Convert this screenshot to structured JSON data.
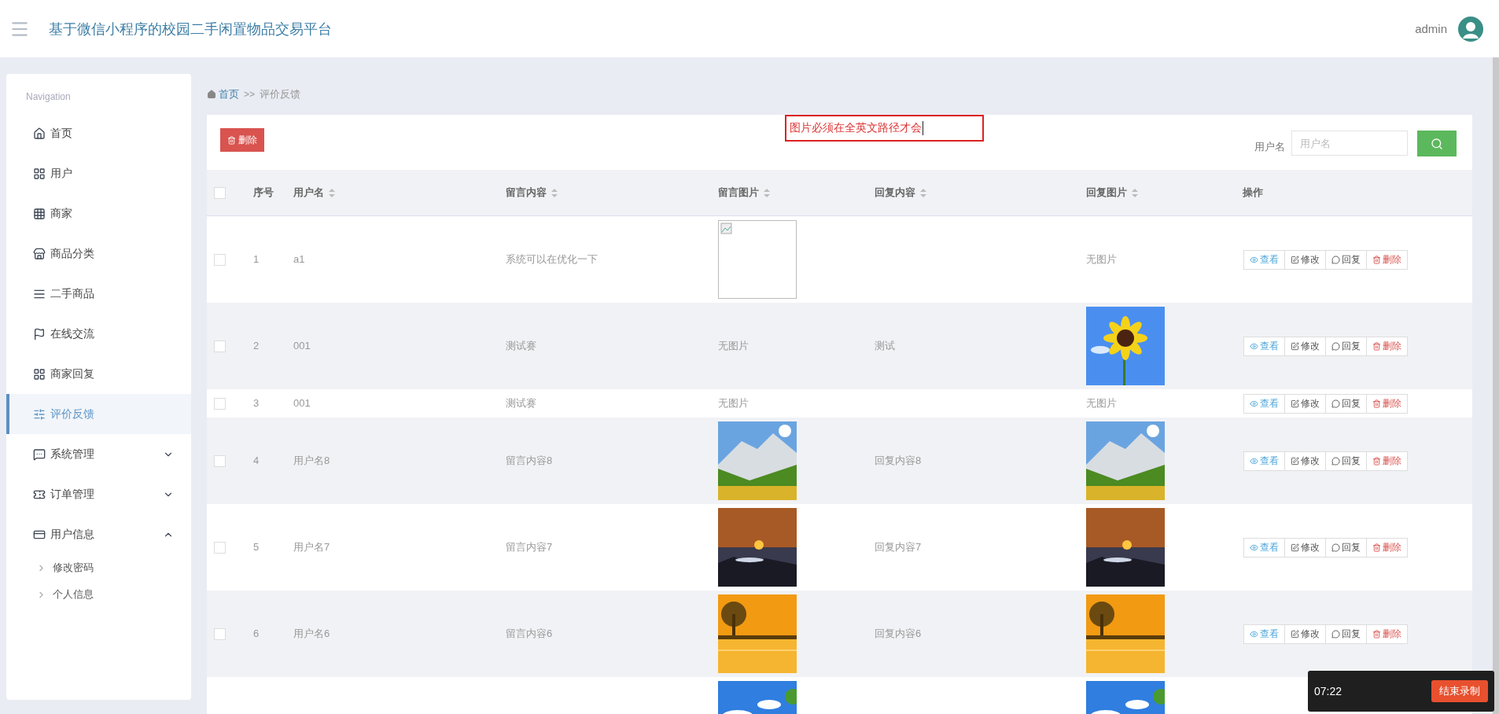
{
  "header": {
    "title": "基于微信小程序的校园二手闲置物品交易平台",
    "user": "admin"
  },
  "sidebar": {
    "heading": "Navigation",
    "items": [
      {
        "label": "首页",
        "selected": false
      },
      {
        "label": "用户",
        "selected": false
      },
      {
        "label": "商家",
        "selected": false
      },
      {
        "label": "商品分类",
        "selected": false
      },
      {
        "label": "二手商品",
        "selected": false
      },
      {
        "label": "在线交流",
        "selected": false
      },
      {
        "label": "商家回复",
        "selected": false
      },
      {
        "label": "评价反馈",
        "selected": true
      },
      {
        "label": "系统管理",
        "selected": false,
        "expanded": false
      },
      {
        "label": "订单管理",
        "selected": false,
        "expanded": false
      },
      {
        "label": "用户信息",
        "selected": false,
        "expanded": true,
        "children": [
          {
            "label": "修改密码"
          },
          {
            "label": "个人信息"
          }
        ]
      }
    ]
  },
  "breadcrumb": {
    "home": "首页",
    "separator": ">>",
    "current": "评价反馈"
  },
  "toolbar": {
    "delete_button": "删除",
    "search_label": "用户名",
    "search_placeholder": "用户名"
  },
  "annotation": {
    "text": "图片必须在全英文路径才会"
  },
  "table": {
    "columns": [
      {
        "label": "序号",
        "sortable": false
      },
      {
        "label": "用户名",
        "sortable": true
      },
      {
        "label": "留言内容",
        "sortable": true
      },
      {
        "label": "留言图片",
        "sortable": true
      },
      {
        "label": "回复内容",
        "sortable": true
      },
      {
        "label": "回复图片",
        "sortable": true
      },
      {
        "label": "操作",
        "sortable": false
      }
    ],
    "header_checked": false,
    "rows": [
      {
        "checked": false,
        "index": "1",
        "user": "a1",
        "message": "系统可以在优化一下",
        "message_picture": {
          "kind": "broken"
        },
        "reply": "",
        "reply_picture": {
          "kind": "none",
          "text": "无图片"
        },
        "actions": [
          {
            "kind": "view",
            "label": "查看"
          },
          {
            "kind": "edit",
            "label": "修改"
          },
          {
            "kind": "reply",
            "label": "回复"
          },
          {
            "kind": "delete",
            "label": "删除"
          }
        ]
      },
      {
        "checked": false,
        "index": "2",
        "user": "001",
        "message": "测试赛",
        "message_picture": {
          "kind": "none",
          "text": "无图片"
        },
        "reply": "测试",
        "reply_picture": {
          "kind": "picture"
        },
        "actions": [
          {
            "kind": "view",
            "label": "查看"
          },
          {
            "kind": "edit",
            "label": "修改"
          },
          {
            "kind": "reply",
            "label": "回复"
          },
          {
            "kind": "delete",
            "label": "删除"
          }
        ]
      },
      {
        "checked": false,
        "index": "3",
        "user": "001",
        "message": "测试赛",
        "message_picture": {
          "kind": "none",
          "text": "无图片"
        },
        "reply": "",
        "reply_picture": {
          "kind": "none",
          "text": "无图片"
        },
        "actions": [
          {
            "kind": "view",
            "label": "查看"
          },
          {
            "kind": "edit",
            "label": "修改"
          },
          {
            "kind": "reply",
            "label": "回复"
          },
          {
            "kind": "delete",
            "label": "删除"
          }
        ]
      },
      {
        "checked": false,
        "index": "4",
        "user": "用户名8",
        "message": "留言内容8",
        "message_picture": {
          "kind": "picture"
        },
        "reply": "回复内容8",
        "reply_picture": {
          "kind": "picture"
        },
        "actions": [
          {
            "kind": "view",
            "label": "查看"
          },
          {
            "kind": "edit",
            "label": "修改"
          },
          {
            "kind": "reply",
            "label": "回复"
          },
          {
            "kind": "delete",
            "label": "删除"
          }
        ]
      },
      {
        "checked": false,
        "index": "5",
        "user": "用户名7",
        "message": "留言内容7",
        "message_picture": {
          "kind": "picture"
        },
        "reply": "回复内容7",
        "reply_picture": {
          "kind": "picture"
        },
        "actions": [
          {
            "kind": "view",
            "label": "查看"
          },
          {
            "kind": "edit",
            "label": "修改"
          },
          {
            "kind": "reply",
            "label": "回复"
          },
          {
            "kind": "delete",
            "label": "删除"
          }
        ]
      },
      {
        "checked": false,
        "index": "6",
        "user": "用户名6",
        "message": "留言内容6",
        "message_picture": {
          "kind": "picture"
        },
        "reply": "回复内容6",
        "reply_picture": {
          "kind": "picture"
        },
        "actions": [
          {
            "kind": "view",
            "label": "查看"
          },
          {
            "kind": "edit",
            "label": "修改"
          },
          {
            "kind": "reply",
            "label": "回复"
          },
          {
            "kind": "delete",
            "label": "删除"
          }
        ]
      },
      {
        "message_picture": {
          "kind": "picture"
        },
        "reply_picture": {
          "kind": "picture"
        }
      }
    ]
  },
  "recorder": {
    "time": "07:22",
    "stop_button": "结束录制"
  }
}
